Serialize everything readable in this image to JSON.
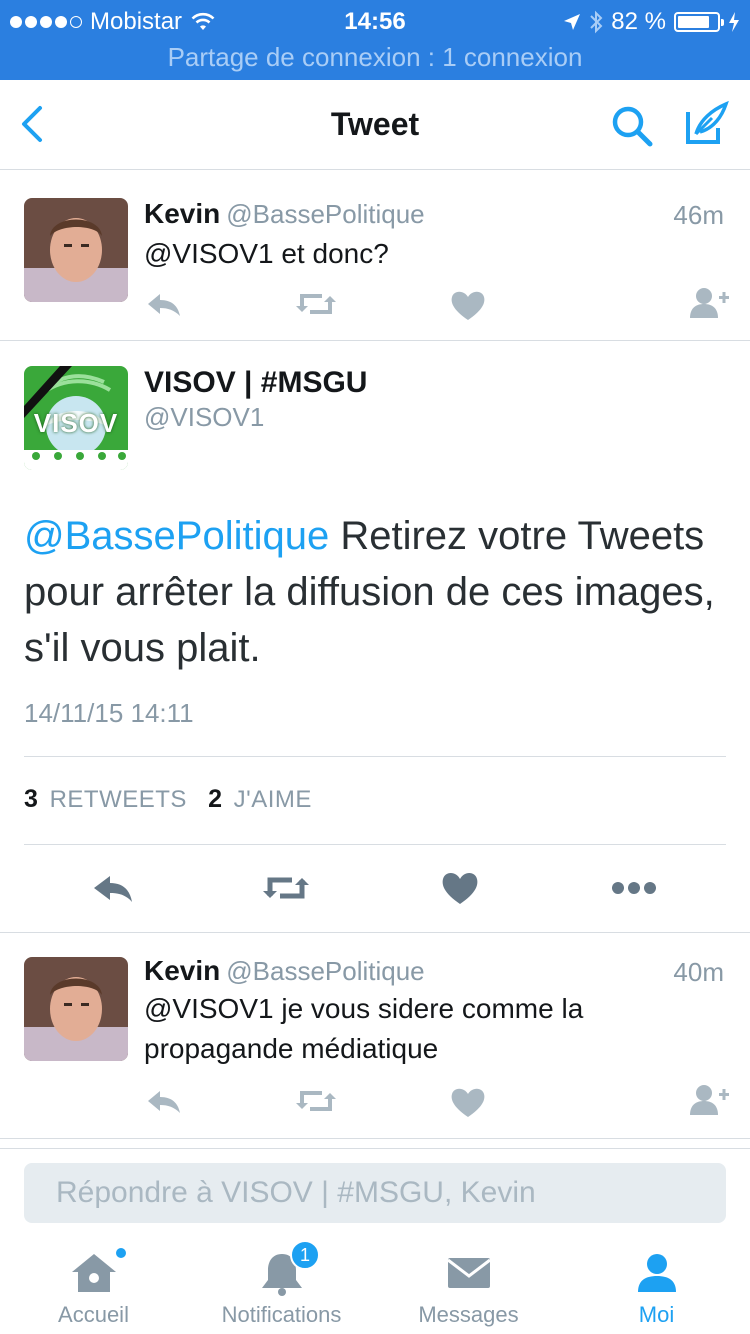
{
  "status_bar": {
    "carrier": "Mobistar",
    "time": "14:56",
    "battery": "82 %",
    "battery_level": 0.82,
    "hotspot": "Partage de connexion : 1 connexion"
  },
  "nav": {
    "title": "Tweet"
  },
  "replies_top": {
    "name": "Kevin",
    "handle": "@BassePolitique",
    "time": "46m",
    "text": "@VISOV1 et donc?"
  },
  "main_tweet": {
    "name": "VISOV | #MSGU",
    "handle": "@VISOV1",
    "avatar_text": "VISOV",
    "mention": "@BassePolitique",
    "text": " Retirez votre Tweets pour arrêter la diffusion de ces images, s'il vous plait.",
    "date": "14/11/15 14:11",
    "retweets_count": "3",
    "retweets_label": "RETWEETS",
    "likes_count": "2",
    "likes_label": "J'AIME"
  },
  "replies_bottom": {
    "name": "Kevin",
    "handle": "@BassePolitique",
    "time": "40m",
    "text": "@VISOV1 je vous sidere comme la propagande médiatique"
  },
  "reply_box": {
    "placeholder": "Répondre à VISOV | #MSGU, Kevin"
  },
  "tabs": [
    {
      "label": "Accueil",
      "icon": "home-icon"
    },
    {
      "label": "Notifications",
      "icon": "bell-icon",
      "badge": "1"
    },
    {
      "label": "Messages",
      "icon": "envelope-icon"
    },
    {
      "label": "Moi",
      "icon": "person-icon"
    }
  ],
  "colors": {
    "status_bar": "#2b7fe0",
    "accent": "#1da1f2",
    "muted": "#8899a6",
    "icon_gray": "#aab8c2"
  }
}
